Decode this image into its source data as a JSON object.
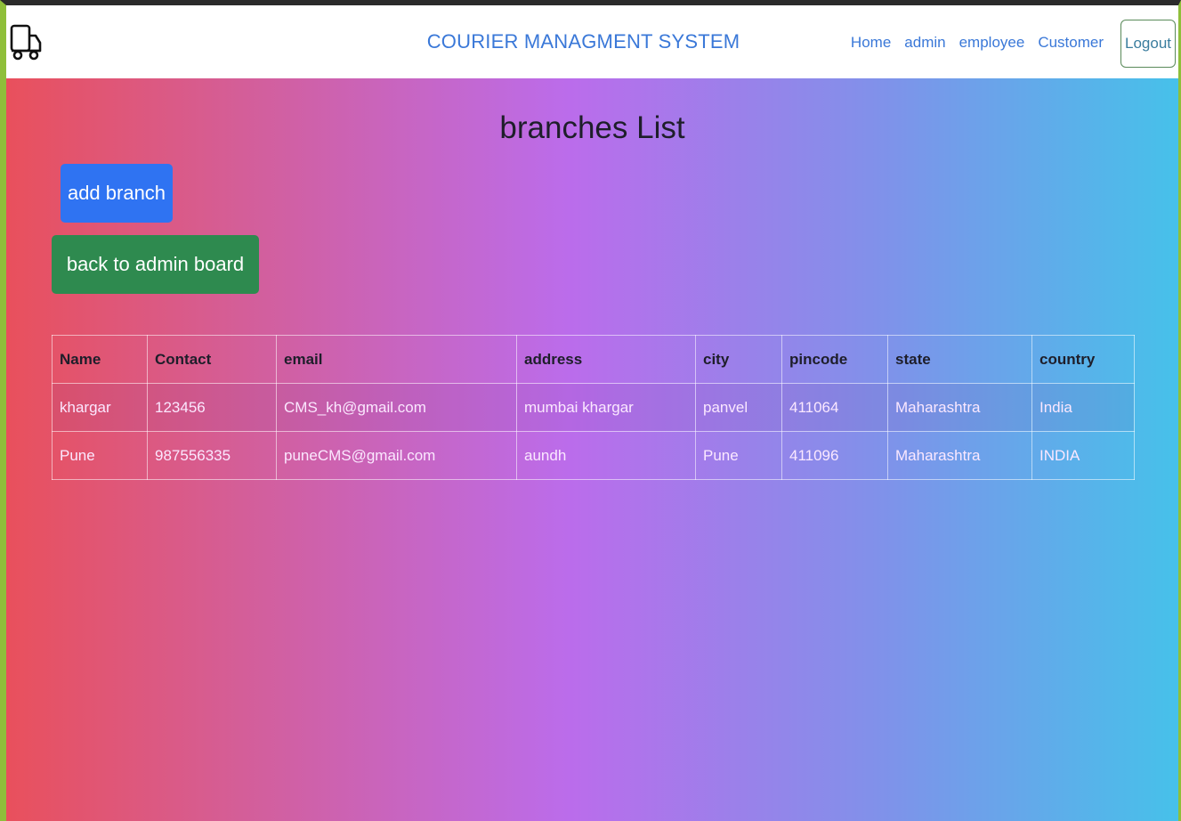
{
  "navbar": {
    "brand": "COURIER MANAGMENT SYSTEM",
    "links": [
      "Home",
      "admin",
      "employee",
      "Customer"
    ],
    "logout_label": "Logout",
    "logo_icon": "truck-icon"
  },
  "page": {
    "title": "branches List",
    "add_button_label": "add branch",
    "back_button_label": "back to admin board"
  },
  "table": {
    "columns": [
      "Name",
      "Contact",
      "email",
      "address",
      "city",
      "pincode",
      "state",
      "country"
    ],
    "rows": [
      [
        "khargar",
        "123456",
        "CMS_kh@gmail.com",
        "mumbai khargar",
        "panvel",
        "411064",
        "Maharashtra",
        "India"
      ],
      [
        "Pune",
        "987556335",
        "puneCMS@gmail.com",
        "aundh",
        "Pune",
        "411096",
        "Maharashtra",
        "INDIA"
      ]
    ]
  },
  "colors": {
    "nav_link": "#3a78d8",
    "add_button": "#2f73f2",
    "back_button": "#2e8a4f",
    "gradient": [
      "#e9505c",
      "#d45e98",
      "#bb6ceb",
      "#7f92ea",
      "#46c1ea"
    ]
  }
}
